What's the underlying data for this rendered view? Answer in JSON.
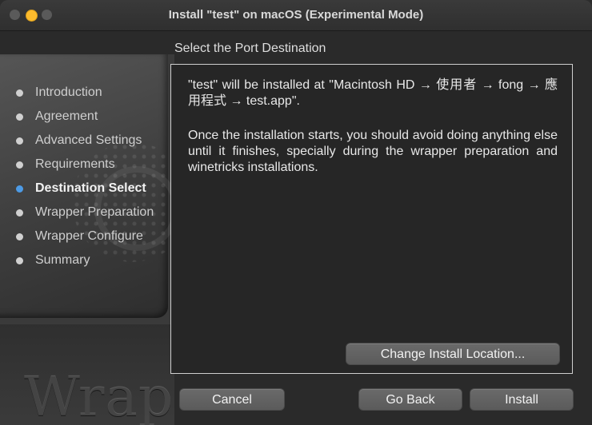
{
  "window": {
    "title": "Install \"test\" on macOS (Experimental Mode)"
  },
  "sidebar": {
    "logo_text": "Wrapper",
    "steps": [
      {
        "label": "Introduction",
        "active": false
      },
      {
        "label": "Agreement",
        "active": false
      },
      {
        "label": "Advanced Settings",
        "active": false
      },
      {
        "label": "Requirements",
        "active": false
      },
      {
        "label": "Destination Select",
        "active": true
      },
      {
        "label": "Wrapper Preparation",
        "active": false
      },
      {
        "label": "Wrapper Configure",
        "active": false
      },
      {
        "label": "Summary",
        "active": false
      }
    ]
  },
  "main": {
    "section_title": "Select the Port Destination",
    "paragraph1": "\"test\" will be installed at \"Macintosh HD → 使用者 → fong → 應用程式 → test.app\".",
    "paragraph2": "Once the installation starts, you should avoid doing anything else until it finishes, specially during the wrapper preparation and winetricks installations.",
    "change_location_label": "Change Install Location..."
  },
  "footer": {
    "cancel_label": "Cancel",
    "back_label": "Go Back",
    "install_label": "Install"
  },
  "colors": {
    "active_bullet": "#4d9be6",
    "minimize_button": "#fcbb2d",
    "window_bg": "#2a2a2a"
  }
}
